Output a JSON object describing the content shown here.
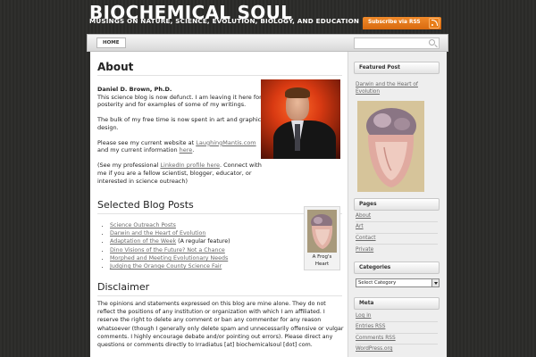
{
  "header": {
    "title": "BIOCHEMICAL SOUL",
    "tagline": "MUSINGS ON NATURE, SCIENCE, EVOLUTION, BIOLOGY, AND EDUCATION",
    "rss_label": "Subscribe via RSS"
  },
  "nav": {
    "home_label": "HOME"
  },
  "main": {
    "page_title": "About",
    "about": {
      "author_name": "Daniel D. Brown, Ph.D.",
      "intro": "This science blog is now defunct. I am leaving it here for posterity and for examples of some of my writings.",
      "free_time": "The bulk of my free time is now spent in art and graphic design.",
      "website_prefix": "Please see my current website at ",
      "website_link": "LaughingMantis.com",
      "website_mid": " and my current information ",
      "website_here": "here",
      "website_end": ".",
      "linkedin_prefix": "(See my professional ",
      "linkedin_link": "LinkedIn profile here",
      "linkedin_suffix": ". Connect with me if you are a fellow scientist, blogger, educator, or interested in science outreach)"
    },
    "selected_posts": {
      "heading": "Selected Blog Posts",
      "items": [
        {
          "link": "Science Outreach Posts",
          "note": ""
        },
        {
          "link": "Darwin and the Heart of Evolution",
          "note": ""
        },
        {
          "link": "Adaptation of the Week",
          "note": " (A regular feature)"
        },
        {
          "link": "Dino Visions of the Future? Not a Chance",
          "note": ""
        },
        {
          "link": "Morphed and Meeting Evolutionary Needs",
          "note": ""
        },
        {
          "link": "Judging the Orange County Science Fair",
          "note": ""
        }
      ],
      "figure_caption_line1": "A Frog's",
      "figure_caption_line2": "Heart"
    },
    "disclaimer": {
      "heading": "Disclaimer",
      "text": "The opinions and statements expressed on this blog are mine alone. They do not reflect the positions of any institution or organization with which I am affiliated. I reserve the right to delete any comment or ban any commenter for any reason whatsoever (though I generally only delete spam and unnecessarily offensive or vulgar comments. I highly encourage debate and/or pointing out errors). Please direct any questions or comments directly to Irradiatus [at] biochemicalsoul [dot] com."
    }
  },
  "sidebar": {
    "featured": {
      "heading": "Featured Post",
      "link": "Darwin and the Heart of Evolution"
    },
    "pages": {
      "heading": "Pages",
      "items": [
        "About",
        "Art",
        "Contact",
        "Private"
      ]
    },
    "categories": {
      "heading": "Categories",
      "selected": "Select Category"
    },
    "meta": {
      "heading": "Meta",
      "items": [
        "Log in",
        "Entries RSS",
        "Comments RSS",
        "WordPress.org"
      ]
    }
  },
  "colors": {
    "background": "#2d2d2b",
    "rss_orange": "#e87d18",
    "link": "#6a6a6a",
    "sidebar": "#eeeeee"
  }
}
